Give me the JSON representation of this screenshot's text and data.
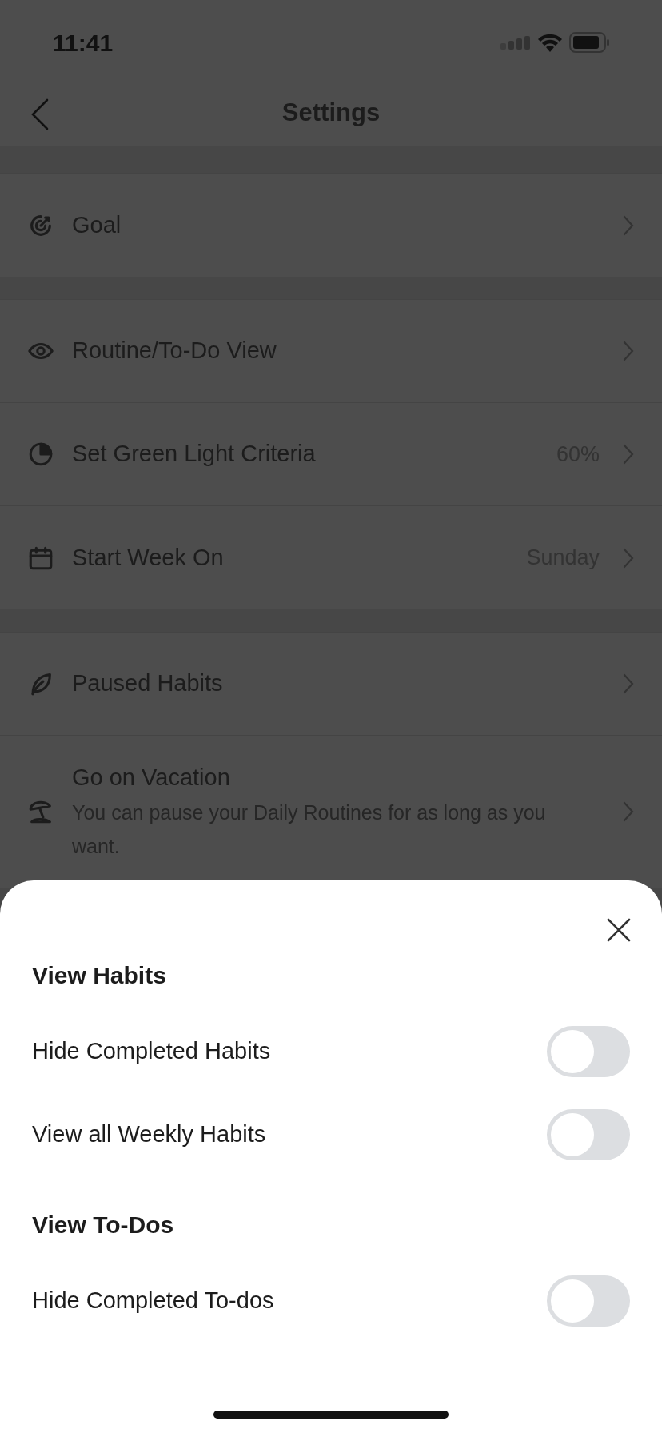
{
  "status_bar": {
    "time": "11:41"
  },
  "nav": {
    "title": "Settings"
  },
  "sections": [
    {
      "rows": [
        {
          "label": "Goal"
        }
      ]
    },
    {
      "rows": [
        {
          "label": "Routine/To-Do View"
        },
        {
          "label": "Set Green Light Criteria",
          "value": "60%"
        },
        {
          "label": "Start Week On",
          "value": "Sunday"
        }
      ]
    },
    {
      "rows": [
        {
          "label": "Paused Habits"
        },
        {
          "label": "Go on Vacation",
          "description": "You can pause your Daily Routines for as long as you want."
        }
      ]
    }
  ],
  "sheet": {
    "groups": [
      {
        "title": "View Habits",
        "toggles": [
          {
            "label": "Hide Completed Habits",
            "on": false
          },
          {
            "label": "View all Weekly Habits",
            "on": false
          }
        ]
      },
      {
        "title": "View To-Dos",
        "toggles": [
          {
            "label": "Hide Completed To-dos",
            "on": false
          }
        ]
      }
    ]
  }
}
